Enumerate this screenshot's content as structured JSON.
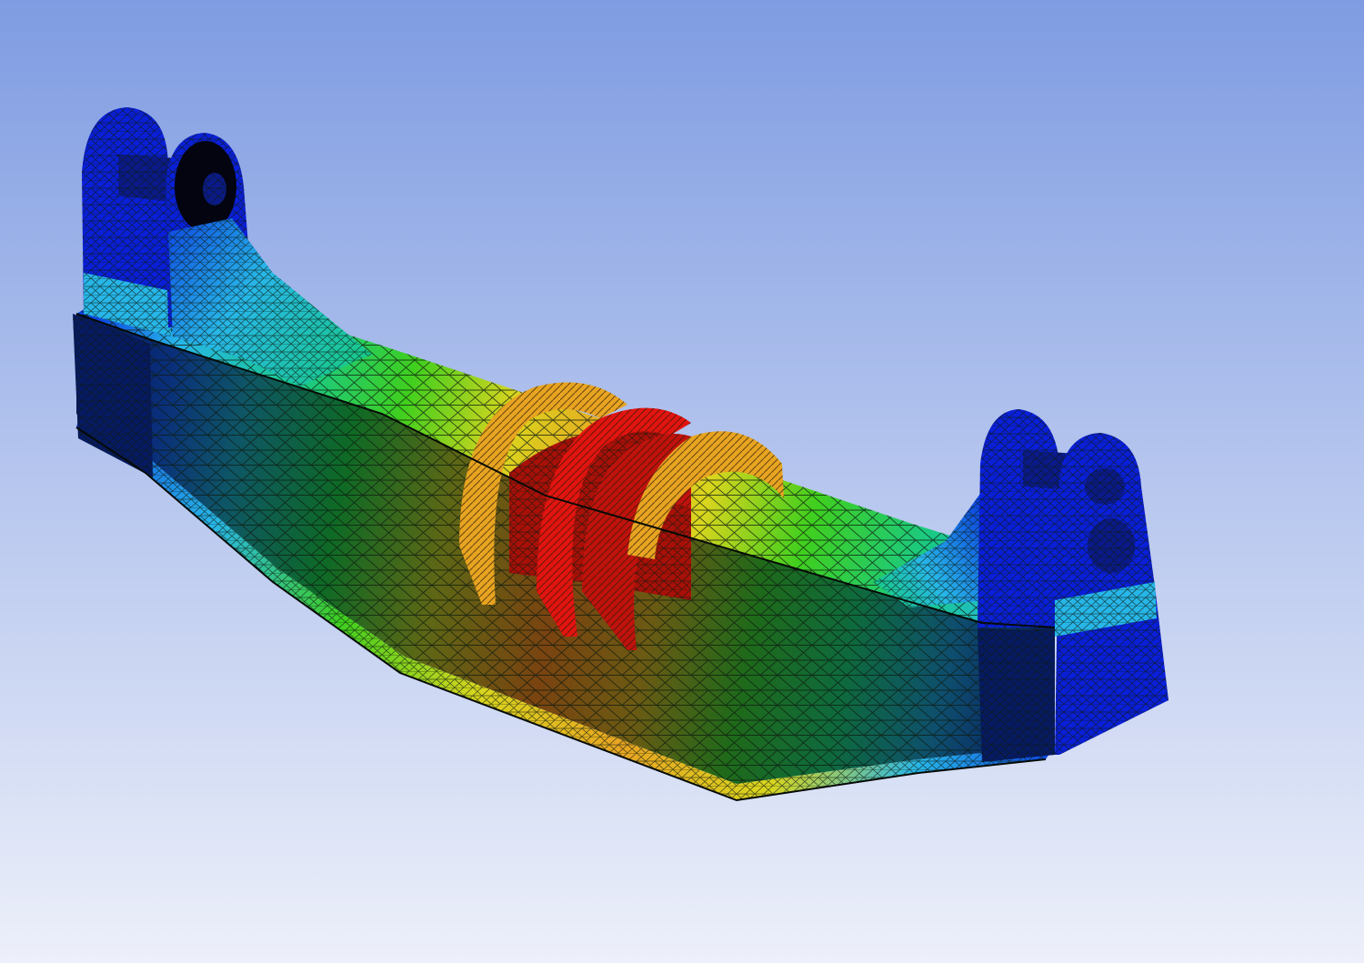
{
  "viewport": {
    "background_top": "#7f9ce2",
    "background_bottom": "#edf0fa",
    "mesh_line_color": "#0d1a10"
  },
  "model": {
    "part": "bogie-beam-fea-mesh",
    "contour_colors": {
      "min": "#0a1fd8",
      "low": "#0c45e0",
      "low_mid": "#27b6e8",
      "mid": "#18c98a",
      "mid_high": "#3fcf1e",
      "high": "#d9d51e",
      "high_max": "#e8a421",
      "max": "#e21410"
    },
    "shaded_side_colors": {
      "dark_blue": "#061a63",
      "teal": "#0e5666",
      "green": "#0e6a25",
      "olive": "#5e6715",
      "brown": "#7a4310"
    }
  }
}
